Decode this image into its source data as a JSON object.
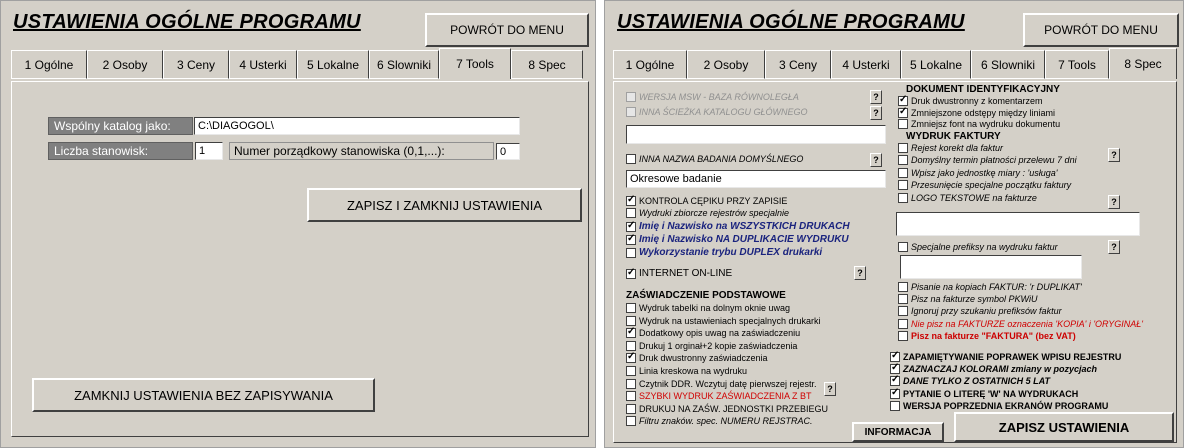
{
  "left": {
    "title": "USTAWIENIA OGÓLNE  PROGRAMU",
    "back_button": "POWRÓT DO MENU",
    "tabs": [
      {
        "label": "1 Ogólne"
      },
      {
        "label": "2 Osoby"
      },
      {
        "label": "3 Ceny"
      },
      {
        "label": "4 Usterki"
      },
      {
        "label": "5 Lokalne"
      },
      {
        "label": "6 Slowniki"
      },
      {
        "label": "7 Tools"
      },
      {
        "label": "8 Spec"
      }
    ],
    "active_tab": "7 Tools",
    "shared_catalog_label": "Wspólny katalog jako:",
    "shared_catalog_value": "C:\\DIAGOGOL\\",
    "stations_label": "Liczba stanowisk:",
    "stations_value": "1",
    "station_number_label": "Numer porządkowy stanowiska (0,1,...):",
    "station_number_value": "0",
    "save_close_button": "ZAPISZ I ZAMKNIJ USTAWIENIA",
    "close_nosave_button": "ZAMKNIJ USTAWIENIA BEZ ZAPISYWANIA"
  },
  "right": {
    "title": "USTAWIENIA OGÓLNE  PROGRAMU",
    "back_button": "POWRÓT DO MENU",
    "tabs": [
      {
        "label": "1 Ogólne"
      },
      {
        "label": "2 Osoby"
      },
      {
        "label": "3 Ceny"
      },
      {
        "label": "4 Usterki"
      },
      {
        "label": "5 Lokalne"
      },
      {
        "label": "6 Slowniki"
      },
      {
        "label": "7 Tools"
      },
      {
        "label": "8 Spec"
      }
    ],
    "active_tab": "8 Spec",
    "col1": {
      "mswb_label": "WERSJA MSW - BAZA RÓWNOLEGŁA",
      "other_path_label": "INNA ŚCIEŻKA KATALOGU GŁÓWNEGO",
      "other_path_value": "",
      "other_test_name_label": "INNA NAZWA BADANIA DOMYŚLNEGO",
      "other_test_name_value": "Okresowe badanie",
      "stamp_control": "KONTROLA CĘPIKU PRZY ZAPISIE",
      "summary_prints": "Wydruki zbiorcze rejestrów specjalnie",
      "name_all_prints": "Imię i Nazwisko na WSZYSTKICH DRUKACH",
      "name_duplicate": "Imię i Nazwisko NA DUPLIKACIE WYDRUKU",
      "duplex_use": "Wykorzystanie trybu DUPLEX drukarki",
      "internet_online": "INTERNET ON-LINE",
      "cert_section": "ZAŚWIADCZENIE PODSTAWOWE",
      "cert_items": [
        {
          "label": "Wydruk tabelki na dolnym oknie uwag",
          "checked": false
        },
        {
          "label": "Wydruk na ustawieniach specjalnych drukarki",
          "checked": false
        },
        {
          "label": "Dodatkowy opis uwag na zaświadczeniu",
          "checked": true
        },
        {
          "label": "Drukuj 1 orginał+2 kopie zaświadczenia",
          "checked": false
        },
        {
          "label": "Druk dwustronny zaświadczenia",
          "checked": true
        },
        {
          "label": "Linia kreskowa na wydruku",
          "checked": false
        },
        {
          "label": "Czytnik DDR. Wczytuj datę pierwszej rejestr.",
          "checked": false
        },
        {
          "label": "SZYBKI WYDRUK ZAŚWIADCZENIA Z BT",
          "checked": false
        },
        {
          "label": "DRUKUJ NA ZAŚW. JEDNOSTKI PRZEBIEGU",
          "checked": false
        },
        {
          "label": "Filtru znaków. spec. NUMERU REJSTRAC.",
          "checked": false
        }
      ],
      "info_button": "INFORMACJA"
    },
    "col2": {
      "id_doc_section": "DOKUMENT IDENTYFIKACYJNY",
      "id_doc_items": [
        {
          "label": "Druk dwustronny z komentarzem",
          "checked": true
        },
        {
          "label": "Zmniejszone odstępy między liniami",
          "checked": true
        },
        {
          "label": "Zmniejsz font na wydruku dokumentu",
          "checked": false
        }
      ],
      "invoice_section": "WYDRUK FAKTURY",
      "invoice_items": [
        {
          "label": "Rejest korekt dla faktur",
          "checked": false
        },
        {
          "label": "Domyślny termin płatności przelewu 7 dni",
          "checked": false
        },
        {
          "label": "Wpisz  jako jednostkę miary : 'usługa'",
          "checked": false
        },
        {
          "label": "Przesunięcie specjalne początku faktury",
          "checked": false
        },
        {
          "label": "LOGO TEKSTOWE na fakturze",
          "checked": false
        }
      ],
      "logo_text_value": "",
      "prefix_label": "Specjalne prefiksy na wydruku faktur",
      "prefix_value": "",
      "invoice_items2": [
        {
          "label": "Pisanie na kopiach FAKTUR: 'r DUPLIKAT'",
          "checked": false
        },
        {
          "label": "Pisz na fakturze symbol PKWiU",
          "checked": false
        },
        {
          "label": "Ignoruj przy szukaniu prefiksów faktur",
          "checked": false
        },
        {
          "label": "Nie pisz na FAKTURZE oznaczenia 'KOPIA' i 'ORYGINAŁ'",
          "checked": false
        },
        {
          "label": "Pisz na fakturze \"FAKTURA\" (bez VAT)",
          "checked": false
        }
      ],
      "bottom_items": [
        {
          "label": "ZAPAMIĘTYWANIE POPRAWEK WPISU REJESTRU",
          "checked": true
        },
        {
          "label": "ZAZNACZAJ KOLORAMI zmiany w pozycjach",
          "checked": true
        },
        {
          "label": "DANE TYLKO Z OSTATNICH 5 LAT",
          "checked": true
        },
        {
          "label": "PYTANIE O LITERĘ 'W' NA WYDRUKACH",
          "checked": true
        },
        {
          "label": "WERSJA POPRZEDNIA EKRANÓW PROGRAMU",
          "checked": false
        }
      ],
      "save_button": "ZAPISZ USTAWIENIA"
    },
    "help_label": "?"
  }
}
